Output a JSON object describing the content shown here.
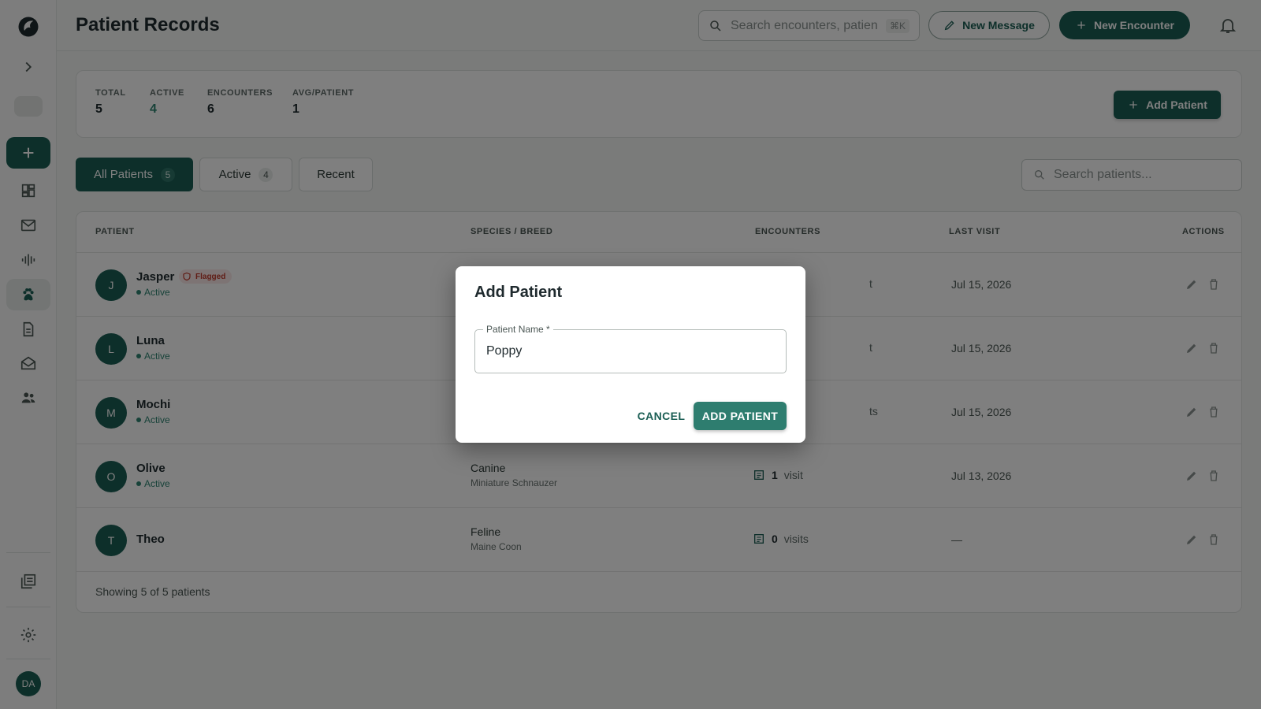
{
  "app": {
    "page_title": "Patient Records"
  },
  "header": {
    "search_placeholder": "Search encounters, patien",
    "search_shortcut": "⌘K",
    "new_message": "New Message",
    "new_encounter": "New Encounter"
  },
  "sidebar": {
    "user_initials": "DA",
    "icons": [
      "logo-icon",
      "chevron-right-icon",
      "add-icon",
      "dashboard-icon",
      "mail-icon",
      "waveform-icon",
      "paw-icon",
      "document-icon",
      "inbox-icon",
      "people-icon",
      "library-icon",
      "gear-icon"
    ],
    "active_item": "paw-icon"
  },
  "stats": {
    "total_label": "TOTAL",
    "total_value": "5",
    "active_label": "ACTIVE",
    "active_value": "4",
    "encounters_label": "ENCOUNTERS",
    "encounters_value": "6",
    "avg_label": "AVG/PATIENT",
    "avg_value": "1",
    "add_patient": "Add Patient"
  },
  "tabs": [
    {
      "label": "All Patients",
      "count": "5"
    },
    {
      "label": "Active",
      "count": "4"
    },
    {
      "label": "Recent"
    }
  ],
  "list_search_placeholder": "Search patients...",
  "table": {
    "headers": [
      "PATIENT",
      "SPECIES / BREED",
      "ENCOUNTERS",
      "LAST VISIT",
      "ACTIONS"
    ],
    "rows": [
      {
        "initial": "J",
        "name": "Jasper",
        "status": "Active",
        "flag": "Flagged",
        "species": "",
        "breed": "",
        "enc_count": "",
        "enc_unit": "t",
        "last_visit": "Jul 15, 2026"
      },
      {
        "initial": "L",
        "name": "Luna",
        "status": "Active",
        "species": "",
        "breed": "",
        "enc_count": "",
        "enc_unit": "t",
        "last_visit": "Jul 15, 2026"
      },
      {
        "initial": "M",
        "name": "Mochi",
        "status": "Active",
        "species": "",
        "breed": "",
        "enc_count": "",
        "enc_unit": "ts",
        "last_visit": "Jul 15, 2026"
      },
      {
        "initial": "O",
        "name": "Olive",
        "status": "Active",
        "species": "Canine",
        "breed": "Miniature Schnauzer",
        "enc_count": "1",
        "enc_unit": "visit",
        "last_visit": "Jul 13, 2026"
      },
      {
        "initial": "T",
        "name": "Theo",
        "status": "",
        "species": "Feline",
        "breed": "Maine Coon",
        "enc_count": "0",
        "enc_unit": "visits",
        "last_visit": "—"
      }
    ],
    "footer": "Showing 5 of 5 patients"
  },
  "dialog": {
    "title": "Add Patient",
    "field_label": "Patient Name *",
    "field_value": "Poppy",
    "cancel": "CANCEL",
    "submit": "ADD PATIENT"
  },
  "colors": {
    "brand": "#1b5e54",
    "active_status": "#2e8572",
    "flag": "#c0392b"
  }
}
